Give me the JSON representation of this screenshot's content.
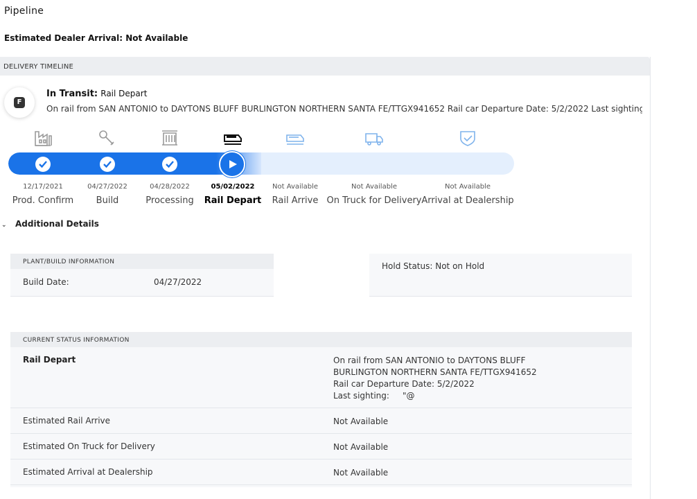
{
  "page": {
    "title": "Pipeline",
    "eta_label": "Estimated Dealer Arrival: Not Available"
  },
  "timeline": {
    "header": "DELIVERY TIMELINE",
    "badge_letter": "F",
    "status_title": "In Transit:",
    "status_sub": "Rail Depart",
    "status_desc": "On rail from SAN ANTONIO to DAYTONS BLUFF BURLINGTON NORTHERN SANTA FE/TTGX941652 Rail car Departure Date: 5/2/2022 Last sighting:     \"@",
    "stages": [
      {
        "date": "12/17/2021",
        "label": "Prod. Confirm",
        "state": "done",
        "icon": "factory-icon"
      },
      {
        "date": "04/27/2022",
        "label": "Build",
        "state": "done",
        "icon": "wrench-icon"
      },
      {
        "date": "04/28/2022",
        "label": "Processing",
        "state": "done",
        "icon": "container-icon"
      },
      {
        "date": "05/02/2022",
        "label": "Rail Depart",
        "state": "current",
        "icon": "train-icon"
      },
      {
        "date": "Not Available",
        "label": "Rail Arrive",
        "state": "pending",
        "icon": "train-icon"
      },
      {
        "date": "Not Available",
        "label": "On Truck for Delivery",
        "state": "pending",
        "icon": "truck-icon"
      },
      {
        "date": "Not Available",
        "label": "Arrival at Dealership",
        "state": "pending",
        "icon": "shield-check-icon"
      }
    ]
  },
  "details": {
    "toggle_label": "Additional Details",
    "plant": {
      "header": "PLANT/BUILD INFORMATION",
      "build_date_label": "Build Date:",
      "build_date_value": "04/27/2022"
    },
    "hold_status": "Hold Status: Not on Hold",
    "current_status": {
      "header": "CURRENT STATUS INFORMATION",
      "rows": [
        {
          "key": "Rail Depart",
          "lines": [
            "On rail from SAN ANTONIO to DAYTONS BLUFF",
            "BURLINGTON NORTHERN SANTA FE/TTGX941652",
            "Rail car Departure Date: 5/2/2022",
            "Last sighting:     \"@"
          ]
        },
        {
          "key": "Estimated Rail Arrive",
          "lines": [
            "Not Available"
          ]
        },
        {
          "key": "Estimated On Truck for Delivery",
          "lines": [
            "Not Available"
          ]
        },
        {
          "key": "Estimated Arrival at Dealership",
          "lines": [
            "Not Available"
          ]
        }
      ]
    }
  },
  "colors": {
    "accent": "#1a73e8",
    "track": "#e4effd",
    "done_icon": "#999999",
    "pending_icon": "#7fb3ec"
  }
}
